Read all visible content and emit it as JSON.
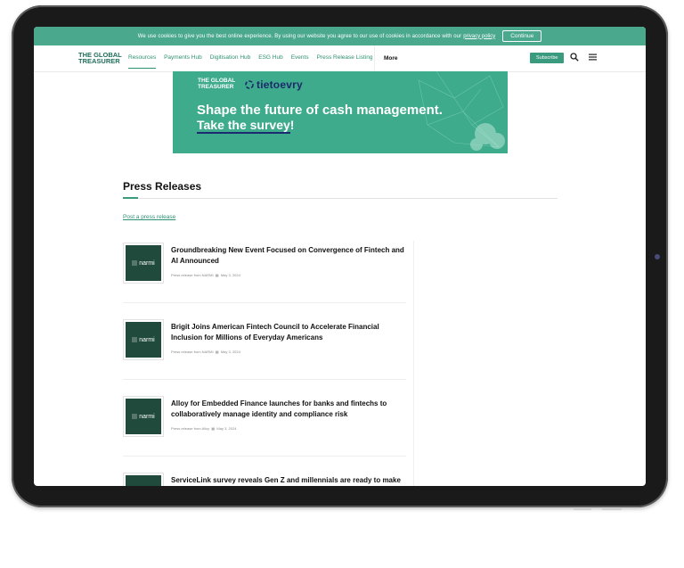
{
  "cookie": {
    "message": "We use cookies to give you the best online experience. By using our website you agree to our use of cookies in accordance with our",
    "link": "privacy policy",
    "button": "Continue"
  },
  "logo": {
    "line1": "THE GLOBAL",
    "line2": "TREASURER"
  },
  "nav": {
    "items": [
      "Resources",
      "Payments Hub",
      "Digitisation Hub",
      "ESG Hub",
      "Events",
      "Press Release Listing"
    ],
    "more": "More",
    "subscribe": "Subscribe"
  },
  "banner": {
    "logo_line1": "THE GLOBAL",
    "logo_line2": "TREASURER",
    "partner": "tietoevry",
    "headline1": "Shape the future of cash management.",
    "headline2_link": "Take the survey",
    "headline2_tail": "!"
  },
  "page": {
    "title": "Press Releases",
    "post_link": "Post a press release"
  },
  "press_releases": [
    {
      "title": "Groundbreaking New Event Focused on Convergence of Fintech and AI Announced",
      "source": "Press release from NARMI",
      "date": "May 3, 2024",
      "thumb": "narmi"
    },
    {
      "title": "Brigit Joins American Fintech Council to Accelerate Financial Inclusion for Millions of Everyday Americans",
      "source": "Press release from NARMI",
      "date": "May 3, 2024",
      "thumb": "narmi"
    },
    {
      "title": "Alloy for Embedded Finance launches for banks and fintechs to collaboratively manage identity and compliance risk",
      "source": "Press release from Alloy",
      "date": "May 3, 2024",
      "thumb": "narmi"
    },
    {
      "title": "ServiceLink survey reveals Gen Z and millennials are ready to make",
      "source": "",
      "date": "",
      "thumb": ""
    }
  ],
  "colors": {
    "brand": "#3a9a7e",
    "brand_dark": "#1f4a3c",
    "banner": "#3eab8c"
  }
}
